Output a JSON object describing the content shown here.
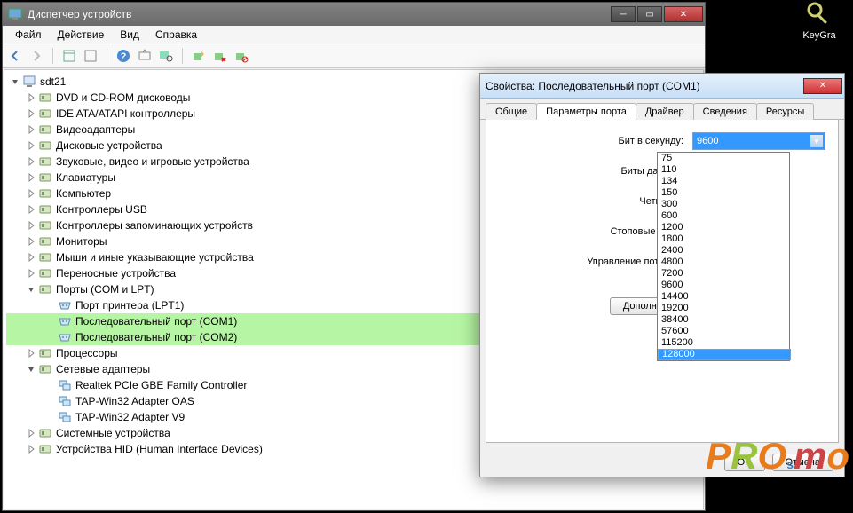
{
  "desktop": {
    "icon_label": "KeyGra"
  },
  "main_window": {
    "title": "Диспетчер устройств",
    "menus": {
      "file": "Файл",
      "action": "Действие",
      "view": "Вид",
      "help": "Справка"
    }
  },
  "tree": {
    "root": "sdt21",
    "items": [
      {
        "label": "DVD и CD-ROM дисководы",
        "depth": 1
      },
      {
        "label": "IDE ATA/ATAPI контроллеры",
        "depth": 1
      },
      {
        "label": "Видеоадаптеры",
        "depth": 1
      },
      {
        "label": "Дисковые устройства",
        "depth": 1
      },
      {
        "label": "Звуковые, видео и игровые устройства",
        "depth": 1
      },
      {
        "label": "Клавиатуры",
        "depth": 1
      },
      {
        "label": "Компьютер",
        "depth": 1
      },
      {
        "label": "Контроллеры USB",
        "depth": 1
      },
      {
        "label": "Контроллеры запоминающих устройств",
        "depth": 1
      },
      {
        "label": "Мониторы",
        "depth": 1
      },
      {
        "label": "Мыши и иные указывающие устройства",
        "depth": 1
      },
      {
        "label": "Переносные устройства",
        "depth": 1
      },
      {
        "label": "Порты (COM и LPT)",
        "depth": 1,
        "expanded": true
      },
      {
        "label": "Порт принтера (LPT1)",
        "depth": 2
      },
      {
        "label": "Последовательный порт (COM1)",
        "depth": 2,
        "hl": true
      },
      {
        "label": "Последовательный порт (COM2)",
        "depth": 2,
        "hl": true
      },
      {
        "label": "Процессоры",
        "depth": 1
      },
      {
        "label": "Сетевые адаптеры",
        "depth": 1,
        "expanded": true
      },
      {
        "label": "Realtek PCIe GBE Family Controller",
        "depth": 2
      },
      {
        "label": "TAP-Win32 Adapter OAS",
        "depth": 2
      },
      {
        "label": "TAP-Win32 Adapter V9",
        "depth": 2
      },
      {
        "label": "Системные устройства",
        "depth": 1
      },
      {
        "label": "Устройства HID (Human Interface Devices)",
        "depth": 1
      }
    ]
  },
  "dialog": {
    "title": "Свойства: Последовательный порт (COM1)",
    "tabs": {
      "general": "Общие",
      "port": "Параметры порта",
      "driver": "Драйвер",
      "details": "Сведения",
      "resources": "Ресурсы"
    },
    "labels": {
      "baud": "Бит в секунду:",
      "databits": "Биты данных:",
      "parity": "Четность:",
      "stopbits": "Стоповые биты:",
      "flow": "Управление потоком:"
    },
    "selected_baud": "9600",
    "baud_options": [
      "75",
      "110",
      "134",
      "150",
      "300",
      "600",
      "1200",
      "1800",
      "2400",
      "4800",
      "7200",
      "9600",
      "14400",
      "19200",
      "38400",
      "57600",
      "115200",
      "128000"
    ],
    "highlighted_option": "128000",
    "advanced_btn": "Дополнительно...",
    "ok": "OK",
    "cancel": "Отмена"
  }
}
